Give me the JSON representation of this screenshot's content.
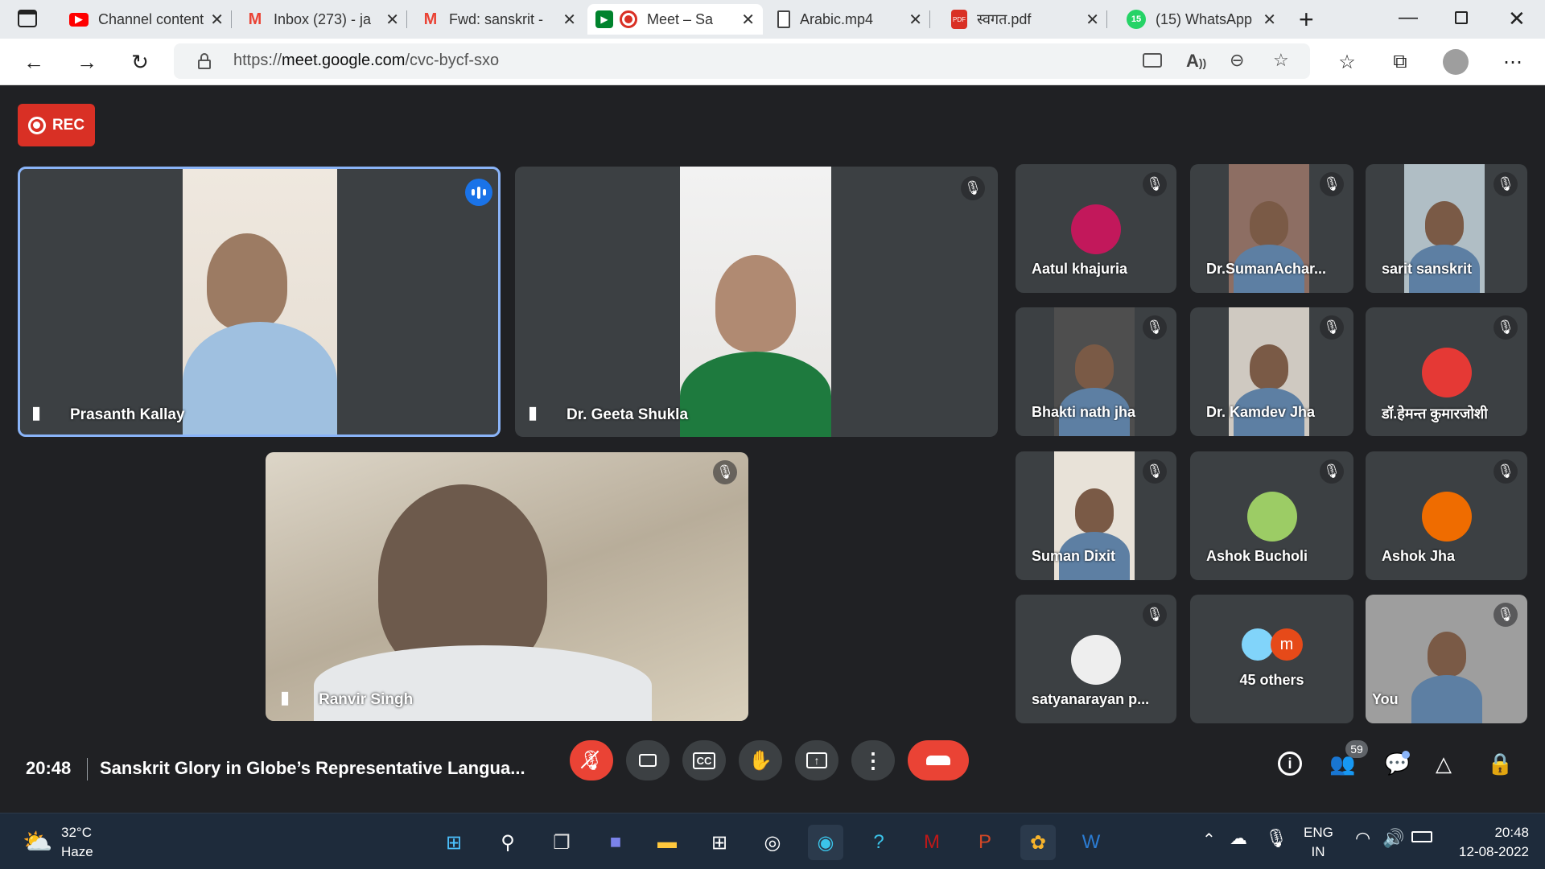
{
  "browser": {
    "tabs": [
      {
        "label": "Channel content",
        "icon": "youtube-icon",
        "color": "#ff0000",
        "active": false
      },
      {
        "label": "Inbox (273) - ja",
        "icon": "gmail-icon",
        "color": "#ea4335",
        "active": false
      },
      {
        "label": "Fwd: sanskrit -",
        "icon": "gmail-icon",
        "color": "#ea4335",
        "active": false
      },
      {
        "label": "Meet – Sa",
        "icon": "meet-icon",
        "color": "#00832d",
        "active": true
      },
      {
        "label": "Arabic.mp4",
        "icon": "file-icon",
        "color": "#444444",
        "active": false
      },
      {
        "label": "स्वगत.pdf",
        "icon": "pdf-icon",
        "color": "#d93025",
        "active": false
      },
      {
        "label": "(15) WhatsApp",
        "icon": "whatsapp-icon",
        "color": "#25d366",
        "active": false
      }
    ],
    "whatsapp_badge": "15",
    "pdf_badge": "PDF",
    "url_prefix": "https://",
    "url_host": "meet.google.com",
    "url_path": "/cvc-bycf-sxo"
  },
  "meet": {
    "rec_label": "REC",
    "main_tiles": [
      {
        "name": "Prasanth Kallay",
        "speaking": true
      },
      {
        "name": "Dr. Geeta Shukla",
        "speaking": false
      },
      {
        "name": "Ranvir Singh",
        "speaking": false
      }
    ],
    "grid": [
      {
        "name": "Aatul khajuria",
        "kind": "avatar",
        "color": "#c2185b"
      },
      {
        "name": "Dr.SumanAchar...",
        "kind": "video",
        "color": "#8d6e63"
      },
      {
        "name": "sarit sanskrit",
        "kind": "video",
        "color": "#b0bec5"
      },
      {
        "name": "Bhakti nath jha",
        "kind": "video",
        "color": "#4e4e4e"
      },
      {
        "name": "Dr. Kamdev Jha",
        "kind": "video",
        "color": "#cfc9c1"
      },
      {
        "name": "डॉ.हेमन्त कुमारजोशी",
        "kind": "avatar",
        "color": "#e53935"
      },
      {
        "name": "Suman Dixit",
        "kind": "video",
        "color": "#e8e2d8"
      },
      {
        "name": "Ashok Bucholi",
        "kind": "avatar",
        "color": "#9ccc65"
      },
      {
        "name": "Ashok Jha",
        "kind": "avatar",
        "color": "#ef6c00"
      },
      {
        "name": "satyanarayan p...",
        "kind": "avatar",
        "color": "#eeeeee"
      },
      {
        "name": "45 others",
        "kind": "others",
        "color": "#e64a19"
      },
      {
        "name": "You",
        "kind": "video",
        "color": "#9e9e9e"
      }
    ],
    "others_initial": "m",
    "time": "20:48",
    "meeting_title": "Sanskrit Glory in Globe’s Representative Langua...",
    "participants_count": "59"
  },
  "taskbar": {
    "weather_temp": "32°C",
    "weather_desc": "Haze",
    "lang_top": "ENG",
    "lang_bottom": "IN",
    "clock_time": "20:48",
    "clock_date": "12-08-2022"
  }
}
